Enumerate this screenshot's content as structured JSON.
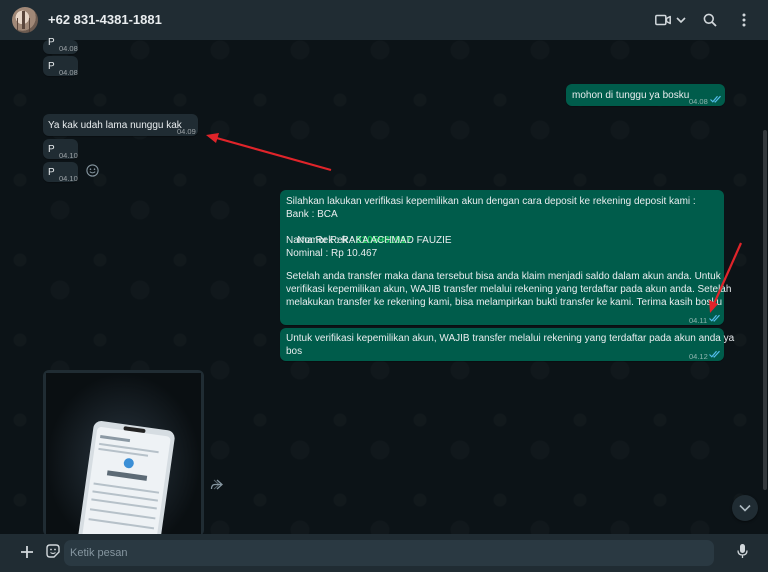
{
  "header": {
    "contact_name": "+62 831-4381-1881",
    "icons": [
      "video-call-icon",
      "chevron-down-icon",
      "search-icon",
      "menu-icon"
    ]
  },
  "messages": [
    {
      "dir": "in",
      "text": "P",
      "time": "04.08"
    },
    {
      "dir": "in",
      "text": "P",
      "time": "04.08"
    },
    {
      "dir": "out",
      "text": "mohon di tunggu ya bosku",
      "time": "04.08"
    },
    {
      "dir": "in",
      "text": "Ya kak udah lama nunggu kak",
      "time": "04.09"
    },
    {
      "dir": "in",
      "text": "P",
      "time": "04.10"
    },
    {
      "dir": "in",
      "text": "P",
      "time": "04.10"
    },
    {
      "dir": "out",
      "lines": {
        "l1": "Silahkan lakukan verifikasi kepemilikan akun dengan cara deposit ke rekening deposit kami :",
        "l2": "Bank : BCA",
        "l3_label": "Nomor Rek : ",
        "l3_value": "8105981917",
        "l4": "Nama Rek : RAKA ACHMAD FAUZIE",
        "l5": "Nominal : Rp 10.467",
        "l6": "Setelah anda transfer maka dana tersebut bisa anda klaim menjadi saldo dalam akun anda. Untuk",
        "l7": "verifikasi kepemilikan akun, WAJIB transfer melalui rekening yang terdaftar pada akun anda. Setelah",
        "l8": "melakukan transfer ke rekening kami, bisa melampirkan bukti transfer ke kami. Terima kasih bosku"
      },
      "time": "04.11"
    },
    {
      "dir": "out",
      "lines": {
        "l1": "Untuk verifikasi kepemilikan akun, WAJIB transfer melalui rekening yang terdaftar pada akun anda ya",
        "l2": "bos"
      },
      "time": "04.12"
    }
  ],
  "composer": {
    "placeholder": "Ketik pesan"
  }
}
